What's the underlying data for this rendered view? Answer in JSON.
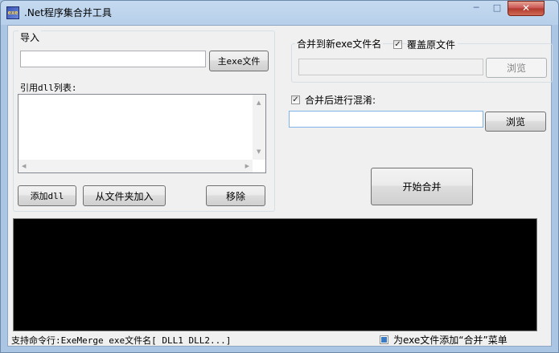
{
  "window": {
    "title": ".Net程序集合并工具",
    "icon_text": "exe",
    "min_glyph": "─",
    "max_glyph": "□",
    "close_glyph": "✕"
  },
  "import_group": {
    "label": "导入",
    "main_exe_value": "",
    "main_exe_button": "主exe文件",
    "dll_list_label": "引用dll列表:",
    "dll_items": [],
    "add_dll_button": "添加dll",
    "add_folder_button": "从文件夹加入",
    "remove_button": "移除"
  },
  "output_group": {
    "label": "合并到新exe文件名",
    "overwrite_label": "覆盖原文件",
    "overwrite_checked": true,
    "path_value": "",
    "browse_button": "浏览"
  },
  "obfuscate": {
    "label": "合并后进行混淆:",
    "checked": true,
    "path_value": "",
    "browse_button": "浏览"
  },
  "start_button": "开始合并",
  "console_text": "",
  "status": {
    "cmdline_text": "支持命令行:ExeMerge exe文件名[ DLL1 DLL2...]",
    "context_menu_label": "为exe文件添加“合并”菜单"
  },
  "icons": {
    "check": "✓",
    "scroll_up": "▲",
    "scroll_down": "▼",
    "scroll_left": "◀",
    "scroll_right": "▶"
  }
}
